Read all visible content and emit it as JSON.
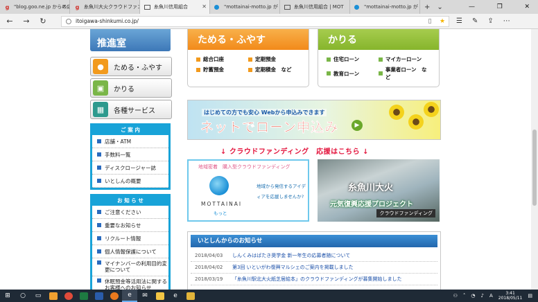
{
  "browser": {
    "tabs": [
      {
        "label": "\"blog.goo.ne.jp からの応",
        "favicon": "goo-icon"
      },
      {
        "label": "糸魚川大火クラウドファン",
        "favicon": "goo-icon"
      },
      {
        "label": "糸魚川信用組合",
        "favicon": "site-icon",
        "active": true
      },
      {
        "label": "\"mottainai-motto.jp が",
        "favicon": "mottainai-icon"
      },
      {
        "label": "糸魚川信用組合 | MOT",
        "favicon": "site-icon"
      },
      {
        "label": "\"mottainai-motto.jp が",
        "favicon": "mottainai-icon"
      }
    ],
    "url": "itoigawa-shinkumi.co.jp/"
  },
  "sidebar": {
    "promo_label": "推進室",
    "nav": [
      {
        "label": "ためる・ふやす",
        "icon": "piggy-icon"
      },
      {
        "label": "かりる",
        "icon": "loan-icon"
      },
      {
        "label": "各種サービス",
        "icon": "service-icon"
      }
    ],
    "guide": {
      "title": "ご 案 内",
      "items": [
        "店舗・ATM",
        "手数料一覧",
        "ディスクロージャー誌",
        "いとしんの概要"
      ]
    },
    "notice": {
      "title": "お 知 ら せ",
      "items": [
        "ご注意ください",
        "重要なお知らせ",
        "リクルート情報",
        "個人情報保護について",
        "マイナンバーの利用目的変更について",
        "休眠預金等活用法に関するお客様へのお知らせ"
      ]
    }
  },
  "panels": {
    "save": {
      "title": "ためる・ふやす",
      "items": [
        "総合口座",
        "定期預金",
        "貯蓄預金",
        "定期積金　など"
      ]
    },
    "borrow": {
      "title": "かりる",
      "items": [
        "住宅ローン",
        "マイカーローン",
        "教育ローン",
        "事業者ローン　など"
      ]
    }
  },
  "loan_banner": {
    "sub": "はじめての方でも安心 Webから申込みできます",
    "main": "ネットでローン申込み"
  },
  "crowdfunding": {
    "header": "↓ クラウドファンディング　応援はこちら ↓",
    "mottainai": {
      "caption": "地域密着　購入型クラウドファンディング",
      "brand": "MOTTAINAI",
      "brand_sub": "もっと",
      "text": "地域から発信するアイディアを応援しませんか?"
    },
    "itoigawa": {
      "title": "糸魚川大火",
      "project": "元気復興応援プロジェクト",
      "badge": "クラウドファンディング"
    }
  },
  "news": {
    "title": "いとしんからのお知らせ",
    "items": [
      {
        "date": "2018/04/03",
        "text": "しんくみはばたき奨学金 新一年生の応募者随について"
      },
      {
        "date": "2018/04/02",
        "text": "第3回 いといがわ復興マルシェのご案内を掲載しました"
      },
      {
        "date": "2018/03/19",
        "text": "「糸魚川駅北大火紙芝居絵本」のクラウドファンディングが募集開始しました"
      }
    ]
  },
  "taskbar": {
    "time": "3:41",
    "date": "2018/05/11",
    "ime": "A"
  }
}
